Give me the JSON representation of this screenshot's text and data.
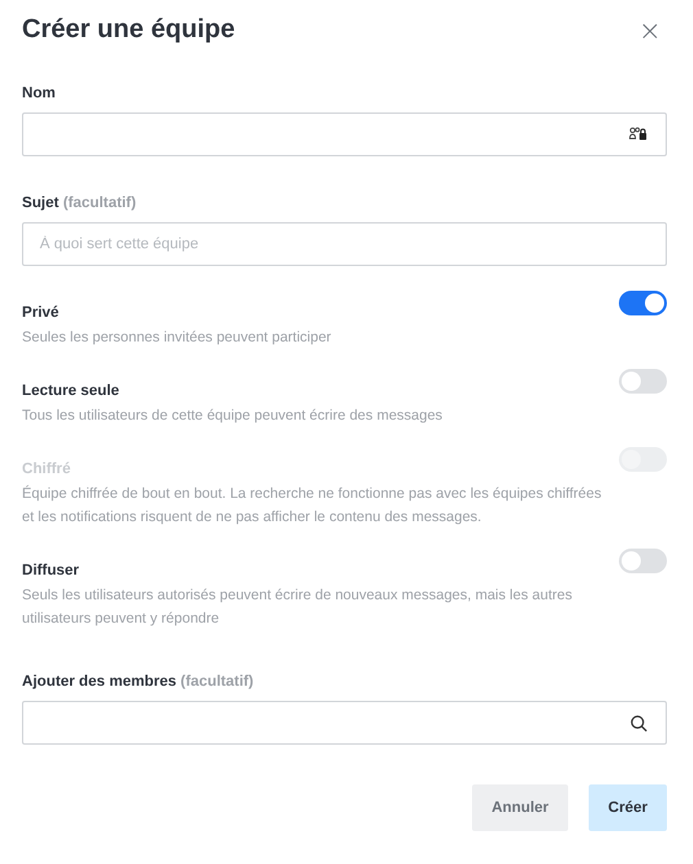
{
  "dialog": {
    "title": "Créer une équipe",
    "close": "×"
  },
  "name_field": {
    "label": "Nom"
  },
  "topic_field": {
    "label": "Sujet",
    "optional": "(facultatif)",
    "placeholder": "À quoi sert cette équipe"
  },
  "options": [
    {
      "label": "Privé",
      "description": "Seules les personnes invitées peuvent participer",
      "on": true,
      "disabled": false
    },
    {
      "label": "Lecture seule",
      "description": "Tous les utilisateurs de cette équipe peuvent écrire des messages",
      "on": false,
      "disabled": false
    },
    {
      "label": "Chiffré",
      "description": "Équipe chiffrée de bout en bout. La recherche ne fonctionne pas avec les équipes chiffrées et les notifications risquent de ne pas afficher le contenu des messages.",
      "on": false,
      "disabled": true
    },
    {
      "label": "Diffuser",
      "description": "Seuls les utilisateurs autorisés peuvent écrire de nouveaux messages, mais les autres utilisateurs peuvent y répondre",
      "on": false,
      "disabled": false
    }
  ],
  "members_field": {
    "label": "Ajouter des membres",
    "optional": "(facultatif)"
  },
  "buttons": [
    {
      "label": "Annuler",
      "kind": "secondary",
      "disabled": false
    },
    {
      "label": "Créer",
      "kind": "primary",
      "disabled": true
    }
  ]
}
